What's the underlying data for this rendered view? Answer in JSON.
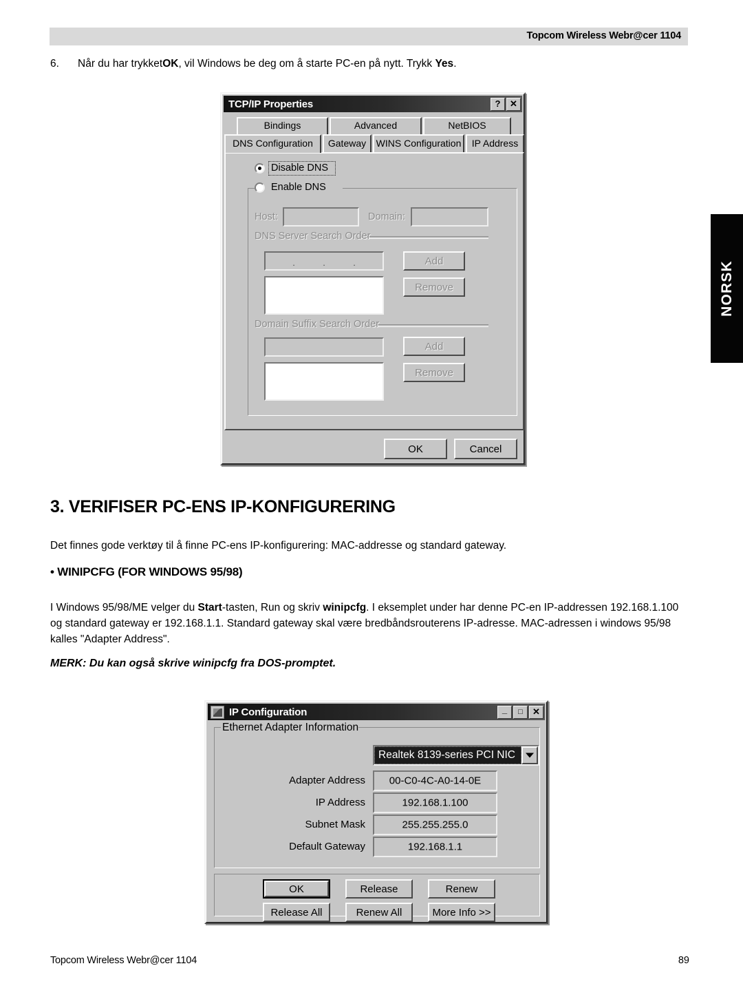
{
  "page": {
    "header_title": "Topcom Wireless Webr@cer 1104",
    "side_tab_label": "NORSK",
    "footer_left": "Topcom Wireless Webr@cer 1104",
    "footer_page_number": "89"
  },
  "step": {
    "number": "6.",
    "text_part1": "Når du har trykket",
    "bold1": "OK",
    "text_part2": ", vil Windows be deg om å starte PC-en på nytt. Trykk ",
    "bold2": "Yes",
    "text_part3": "."
  },
  "tcpip_dialog": {
    "title": "TCP/IP Properties",
    "titlebar_buttons": [
      {
        "name": "help-button",
        "glyph": "?"
      },
      {
        "name": "close-button",
        "glyph": "✕"
      }
    ],
    "tabs_row1": [
      {
        "label": "Bindings",
        "active": false
      },
      {
        "label": "Advanced",
        "active": false
      },
      {
        "label": "NetBIOS",
        "active": false
      }
    ],
    "tabs_row2": [
      {
        "label": "DNS Configuration",
        "active": true
      },
      {
        "label": "Gateway",
        "active": false
      },
      {
        "label": "WINS Configuration",
        "active": false
      },
      {
        "label": "IP Address",
        "active": false
      }
    ],
    "radio_disable_dns": {
      "label": "Disable DNS",
      "checked": true
    },
    "radio_enable_dns": {
      "label": "Enable DNS",
      "checked": false
    },
    "host_label": "Host:",
    "host_value": "",
    "domain_label": "Domain:",
    "domain_value": "",
    "dns_search_group": "DNS Server Search Order",
    "dns_ip_value": "",
    "dns_add_button": "Add",
    "dns_remove_button": "Remove",
    "dns_list_items": [],
    "suffix_search_group": "Domain Suffix Search Order",
    "suffix_value": "",
    "suffix_add_button": "Add",
    "suffix_remove_button": "Remove",
    "suffix_list_items": [],
    "ok_button": "OK",
    "cancel_button": "Cancel"
  },
  "section": {
    "heading": "3.  VERIFISER PC-ENS IP-KONFIGURERING",
    "intro": "Det finnes gode verktøy til å finne PC-ens IP-konfigurering: MAC-addresse og standard gateway.",
    "subheading": "• WINIPCFG (FOR WINDOWS 95/98)",
    "body_line1_a": "I Windows 95/98/ME velger du  ",
    "body_line1_bold1": "Start",
    "body_line1_b": "-tasten, Run og skriv ",
    "body_line1_bold2": "winipcfg",
    "body_line1_c": ". I eksemplet under har denne PC-en IP-addressen",
    "body_line2": "192.168.1.100 og standard gateway er 192.168.1.1. Standard gateway skal være bredbåndsrouterens IP-adresse.",
    "body_line3": "MAC-adressen i windows 95/98 kalles \"Adapter Address\".",
    "note": "MERK: Du kan også skrive winipcfg fra DOS-promptet."
  },
  "ipconfig_dialog": {
    "title": "IP Configuration",
    "titlebar_buttons": [
      {
        "name": "minimize-button",
        "glyph": "_"
      },
      {
        "name": "maximize-button",
        "glyph": "□"
      },
      {
        "name": "close-button",
        "glyph": "✕"
      }
    ],
    "group_label": "Ethernet  Adapter Information",
    "adapter_selected": "Realtek 8139-series PCI NIC",
    "rows": [
      {
        "label": "Adapter Address",
        "value": "00-C0-4C-A0-14-0E"
      },
      {
        "label": "IP Address",
        "value": "192.168.1.100"
      },
      {
        "label": "Subnet Mask",
        "value": "255.255.255.0"
      },
      {
        "label": "Default Gateway",
        "value": "192.168.1.1"
      }
    ],
    "buttons_row1": [
      {
        "label": "OK",
        "default": true
      },
      {
        "label": "Release",
        "default": false
      },
      {
        "label": "Renew",
        "default": false
      }
    ],
    "buttons_row2": [
      {
        "label": "Release All",
        "default": false
      },
      {
        "label": "Renew All",
        "default": false
      },
      {
        "label": "More Info >>",
        "default": false
      }
    ]
  }
}
